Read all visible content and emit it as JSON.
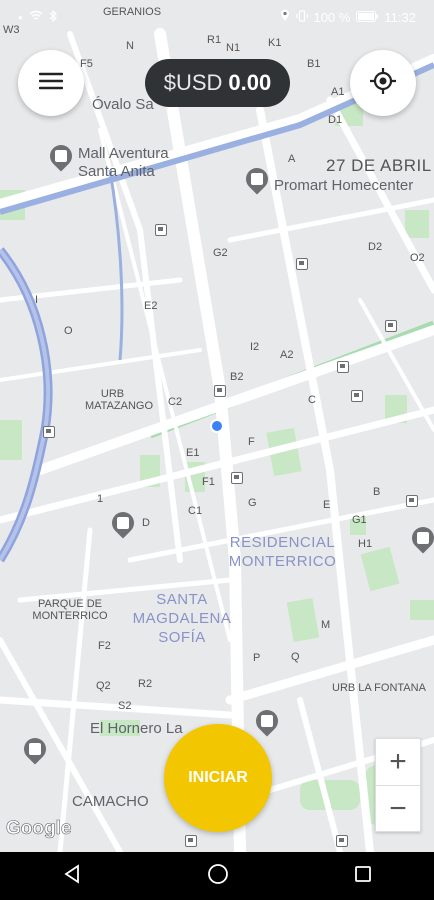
{
  "status_bar": {
    "left_icons": [
      "notification-icon",
      "wifi-icon",
      "bluetooth-icon"
    ],
    "battery_text": "100 %",
    "time": "11:32"
  },
  "map": {
    "pois": [
      {
        "name": "Mall Aventura Santa Anita"
      },
      {
        "name": "Promart Homecenter"
      },
      {
        "name": "El Hornero La"
      }
    ],
    "areas": [
      "RESIDENCIAL MONTERRICO",
      "SANTA MAGDALENA SOFÍA"
    ],
    "places": [
      "Óvalo Sa",
      "27 DE ABRIL",
      "URB MATAZANGO",
      "PARQUE DE MONTERRICO",
      "URB LA FONTANA",
      "CAMACHO",
      "GERANIOS"
    ],
    "block_labels": [
      "N",
      "R1",
      "N1",
      "K1",
      "B1",
      "F5",
      "A1",
      "D1",
      "A",
      "G2",
      "D2",
      "O2",
      "E2",
      "O",
      "I",
      "I2",
      "A2",
      "B2",
      "C2",
      "C",
      "F",
      "E1",
      "F1",
      "G",
      "E",
      "B",
      "1",
      "C1",
      "D",
      "G1",
      "H1",
      "F2",
      "M",
      "P",
      "Q",
      "Q2",
      "R2",
      "S2",
      "W3"
    ]
  },
  "balance": {
    "currency": "$USD",
    "amount": "0.00"
  },
  "buttons": {
    "menu_icon": "hamburger-menu-icon",
    "locate_icon": "my-location-icon",
    "start_label": "INICIAR",
    "zoom_in": "+",
    "zoom_out": "−"
  },
  "attribution": "Google",
  "nav_bar": {
    "icons": [
      "back-icon",
      "home-icon",
      "recents-icon"
    ]
  },
  "colors": {
    "accent_yellow": "#f2c600",
    "balance_bg": "#2f3336",
    "river_blue": "#8fa4dc",
    "park_green": "#c6e8c4",
    "road_white": "#ffffff",
    "location_dot": "#3b82f6"
  }
}
